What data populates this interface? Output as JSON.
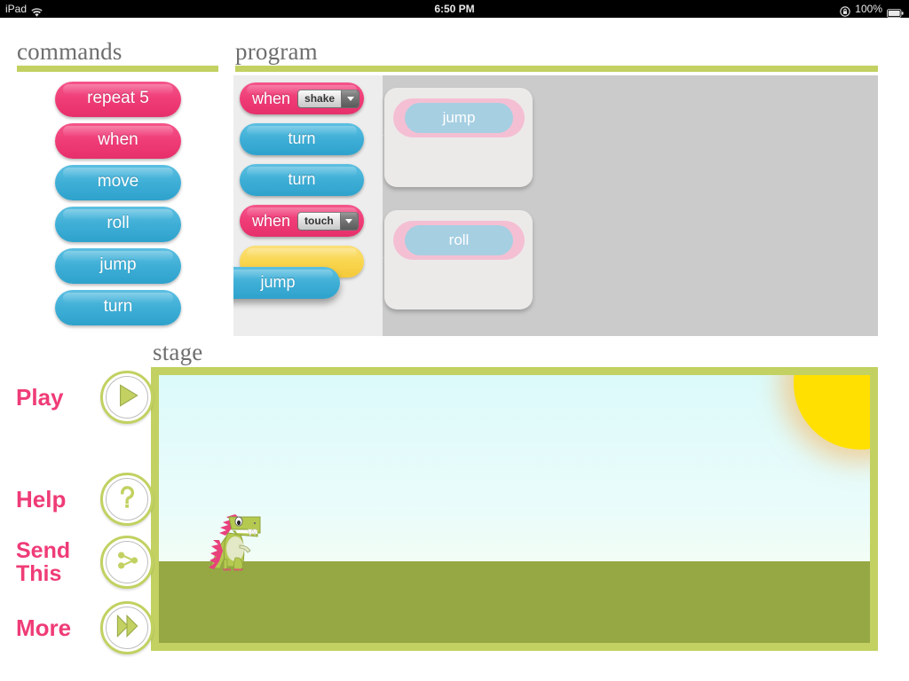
{
  "statusbar": {
    "device": "iPad",
    "wifi_icon": "wifi-icon",
    "time": "6:50 PM",
    "rotation_lock_icon": "rotation-lock-icon",
    "battery_percent": "100%",
    "battery_icon": "battery-full-icon"
  },
  "commands": {
    "title": "commands",
    "blocks": [
      {
        "label": "repeat 5",
        "color": "#ef3c76",
        "kind": "control"
      },
      {
        "label": "when",
        "color": "#ef3c76",
        "kind": "control"
      },
      {
        "label": "move",
        "color": "#3eaed6",
        "kind": "action"
      },
      {
        "label": "roll",
        "color": "#3eaed6",
        "kind": "action"
      },
      {
        "label": "jump",
        "color": "#3eaed6",
        "kind": "action"
      },
      {
        "label": "turn",
        "color": "#3eaed6",
        "kind": "action"
      },
      {
        "label": "",
        "color": "#3eaed6",
        "kind": "action"
      }
    ]
  },
  "program": {
    "title": "program",
    "script": [
      {
        "type": "when",
        "label": "when",
        "dropdown_value": "shake"
      },
      {
        "type": "block",
        "label": "turn"
      },
      {
        "type": "block",
        "label": "turn"
      },
      {
        "type": "when",
        "label": "when",
        "dropdown_value": "touch"
      },
      {
        "type": "placeholder",
        "label": ""
      },
      {
        "type": "dragging",
        "label": "jump"
      }
    ],
    "callouts": [
      {
        "label": "jump"
      },
      {
        "label": "roll"
      }
    ]
  },
  "stage": {
    "title": "stage",
    "sprite": "dinosaur-sprite",
    "sun": "sun-icon",
    "sky_color": "#e2fbfa",
    "ground_color": "#96a843",
    "frame_color": "#c2d161"
  },
  "toolbar": {
    "play": {
      "label": "Play",
      "icon": "play-icon"
    },
    "help": {
      "label": "Help",
      "icon": "question-mark-icon"
    },
    "send": {
      "label_line1": "Send",
      "label_line2": "This",
      "icon": "share-icon"
    },
    "more": {
      "label": "More",
      "icon": "fast-forward-icon"
    }
  },
  "theme": {
    "accent_green": "#c2d161",
    "accent_pink": "#ef3c76",
    "accent_blue": "#3eaed6",
    "accent_yellow": "#f9d64f",
    "heading_gray": "#6e6e6e"
  }
}
